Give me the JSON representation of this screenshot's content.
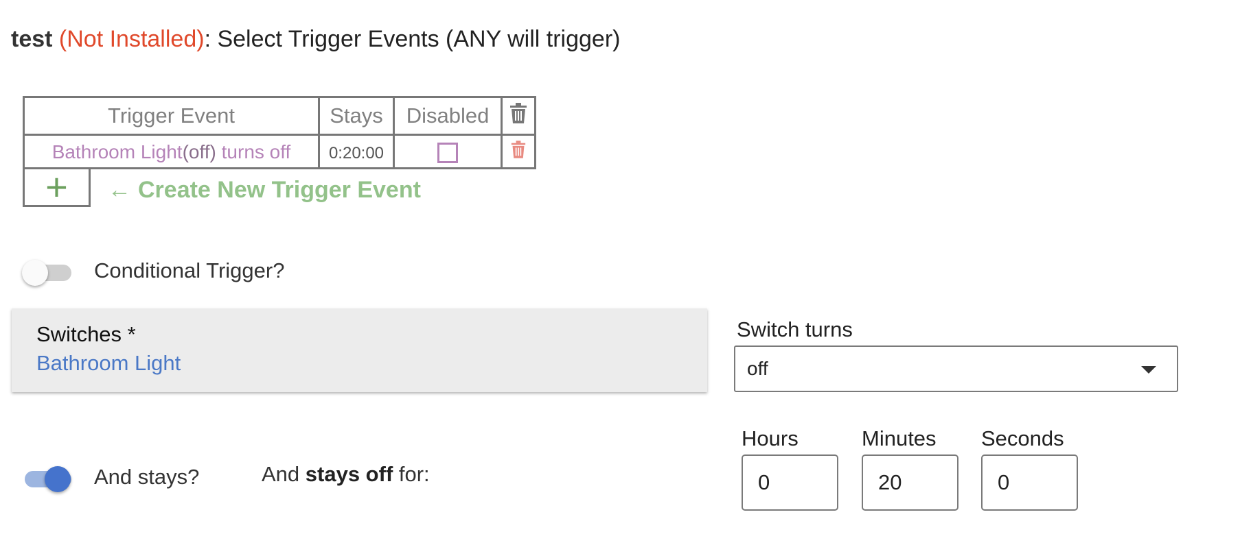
{
  "title": {
    "app_name": "test",
    "status": "(Not Installed)",
    "text": ": Select Trigger Events (ANY will trigger)"
  },
  "trigger_table": {
    "headers": [
      "Trigger Event",
      "Stays",
      "Disabled"
    ],
    "delete_icon": "trash-icon",
    "rows": [
      {
        "event_device": "Bathroom Light",
        "event_state": "(off)",
        "event_action": " turns off",
        "stays": "0:20:00",
        "disabled": false
      }
    ]
  },
  "add_button": {
    "label": "+"
  },
  "create_link": {
    "arrow": "←",
    "label": "Create New Trigger Event"
  },
  "conditional_toggle": {
    "label": "Conditional Trigger?",
    "on": false
  },
  "switches": {
    "label": "Switches *",
    "value": "Bathroom Light"
  },
  "switch_turns": {
    "label": "Switch turns",
    "value": "off"
  },
  "and_stays": {
    "label": "And stays?",
    "on": true,
    "phrase_pre": "And ",
    "phrase_bold": "stays off",
    "phrase_post": " for:"
  },
  "duration": {
    "hours_label": "Hours",
    "hours": "0",
    "minutes_label": "Minutes",
    "minutes": "20",
    "seconds_label": "Seconds",
    "seconds": "0"
  },
  "colors": {
    "status_red": "#e0492b",
    "event_purple": "#b583b8",
    "add_green": "#6ca05e",
    "link_blue": "#4a78c6",
    "toggle_on": "#4573cc",
    "delete_red": "#e88a80"
  }
}
